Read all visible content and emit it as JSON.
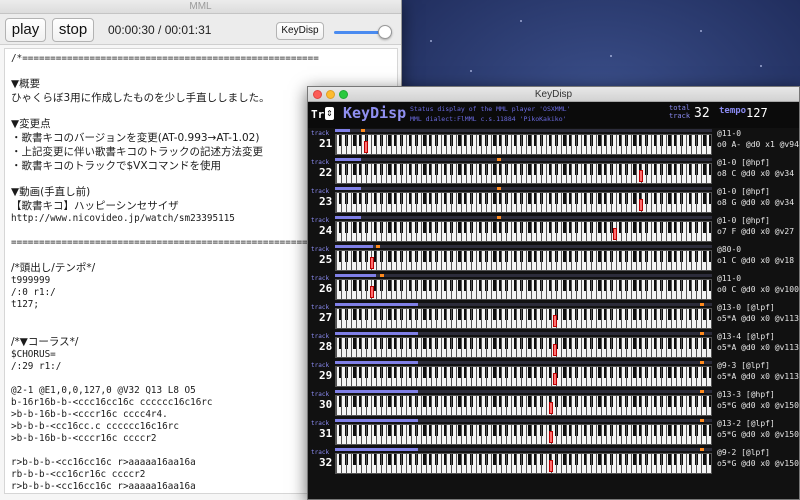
{
  "mml_window": {
    "title": "MML",
    "play_label": "play",
    "stop_label": "stop",
    "time": "00:00:30 / 00:01:31",
    "keydisp_label": "KeyDisp",
    "volume_level": 0.88,
    "editor_lines": [
      {
        "text": "/*=====================================================",
        "jp": false
      },
      {
        "text": "",
        "jp": false
      },
      {
        "text": "▼概要",
        "jp": true
      },
      {
        "text": "ひゃくらぼ3用に作成したものを少し手直ししました。",
        "jp": true
      },
      {
        "text": "",
        "jp": false
      },
      {
        "text": "▼変更点",
        "jp": true
      },
      {
        "text": "・歌書キコのバージョンを変更(AT-0.993→AT-1.02)",
        "jp": true
      },
      {
        "text": "・上記変更に伴い歌書キコのトラックの記述方法変更",
        "jp": true
      },
      {
        "text": "・歌書キコのトラックで$VXコマンドを使用",
        "jp": true
      },
      {
        "text": "",
        "jp": false
      },
      {
        "text": "▼動画(手直し前)",
        "jp": true
      },
      {
        "text": "【歌書キコ】ハッピーシンセサイザ",
        "jp": true
      },
      {
        "text": "http://www.nicovideo.jp/watch/sm23395115",
        "jp": false
      },
      {
        "text": "",
        "jp": false
      },
      {
        "text": "=====================================================*/",
        "jp": false
      },
      {
        "text": "",
        "jp": false
      },
      {
        "text": "/*頭出し/テンポ*/",
        "jp": true
      },
      {
        "text": "t999999",
        "jp": false
      },
      {
        "text": "/:0 r1:/",
        "jp": false
      },
      {
        "text": "t127;",
        "jp": false
      },
      {
        "text": "",
        "jp": false
      },
      {
        "text": "",
        "jp": false
      },
      {
        "text": "/*▼コーラス*/",
        "jp": true
      },
      {
        "text": "$CHORUS=",
        "jp": false
      },
      {
        "text": "/:29 r1:/",
        "jp": false
      },
      {
        "text": "",
        "jp": false
      },
      {
        "text": "@2-1 @E1,0,0,127,0 @V32 Q13 L8 O5",
        "jp": false
      },
      {
        "text": "b-16r16b-b-<ccc16cc16c cccccc16c16rc",
        "jp": false
      },
      {
        "text": ">b-b-16b-b-<cccr16c cccc4r4.",
        "jp": false
      },
      {
        "text": ">b-b-b-<cc16cc.c cccccc16c16rc",
        "jp": false
      },
      {
        "text": ">b-b-16b-b-<cccr16c ccccr2",
        "jp": false
      },
      {
        "text": "",
        "jp": false
      },
      {
        "text": "r>b-b-b-<cc16cc16c r>aaaaa16aa16a",
        "jp": false
      },
      {
        "text": "rb-b-b-<cc16cr16c ccccr2",
        "jp": false
      },
      {
        "text": "r>b-b-b-<cc16cc16c r>aaaaa16aa16a",
        "jp": false
      },
      {
        "text": "rb-b-b-<cc16c",
        "jp": false
      }
    ]
  },
  "keydisp_window": {
    "title": "KeyDisp",
    "tr_label": "Tr",
    "logo": "KeyDisp",
    "status_line1": "Status display of the MML player 'OSXMML'",
    "status_line2": "MML dialect:FlMML c.s.11884 'PikoKakiko'",
    "total_label": "total track",
    "total_tracks": "32",
    "tempo_label": "tempo",
    "tempo_value": "127",
    "track_label_text": "track",
    "tracks": [
      {
        "num": "21",
        "level": 0.04,
        "peak": 0.08,
        "key": 0.075,
        "p1": "@11-0",
        "p2": "o0 A- @d0 x1 @v94"
      },
      {
        "num": "22",
        "level": 0.07,
        "peak": 0.44,
        "key": 0.805,
        "p1": "@1-0 [@hpf]",
        "p2": "o8 C  @d0 x0 @v34"
      },
      {
        "num": "23",
        "level": 0.07,
        "peak": 0.44,
        "key": 0.805,
        "p1": "@1-0 [@hpf]",
        "p2": "o8 G  @d0 x0 @v34"
      },
      {
        "num": "24",
        "level": 0.07,
        "peak": 0.44,
        "key": 0.735,
        "p1": "@1-0 [@hpf]",
        "p2": "o7 F  @d0 x0 @v27"
      },
      {
        "num": "25",
        "level": 0.1,
        "peak": 0.12,
        "key": 0.09,
        "p1": "@80-0",
        "p2": "o1 C  @d0 x0 @v18"
      },
      {
        "num": "26",
        "level": 0.11,
        "peak": 0.13,
        "key": 0.09,
        "p1": "@11-0",
        "p2": "o0 C  @d0 x0 @v100"
      },
      {
        "num": "27",
        "level": 0.22,
        "peak": 0.98,
        "key": 0.575,
        "p1": "@13-0 [@lpf]",
        "p2": "o5*A  @d0 x0 @v113"
      },
      {
        "num": "28",
        "level": 0.22,
        "peak": 0.98,
        "key": 0.575,
        "p1": "@13-4 [@lpf]",
        "p2": "o5*A  @d0 x0 @v113"
      },
      {
        "num": "29",
        "level": 0.22,
        "peak": 0.98,
        "key": 0.575,
        "p1": "@9-3 [@lpf]",
        "p2": "o5*A  @d0 x0 @v113"
      },
      {
        "num": "30",
        "level": 0.22,
        "peak": 0.98,
        "key": 0.565,
        "p1": "@13-3 [@hpf]",
        "p2": "o5*G  @d0 x0 @v150"
      },
      {
        "num": "31",
        "level": 0.22,
        "peak": 0.98,
        "key": 0.565,
        "p1": "@13-2 [@lpf]",
        "p2": "o5*G  @d0 x0 @v150"
      },
      {
        "num": "32",
        "level": 0.22,
        "peak": 0.98,
        "key": 0.565,
        "p1": "@9-2 [@lpf]",
        "p2": "o5*G  @d0 x0 @v150"
      }
    ]
  }
}
